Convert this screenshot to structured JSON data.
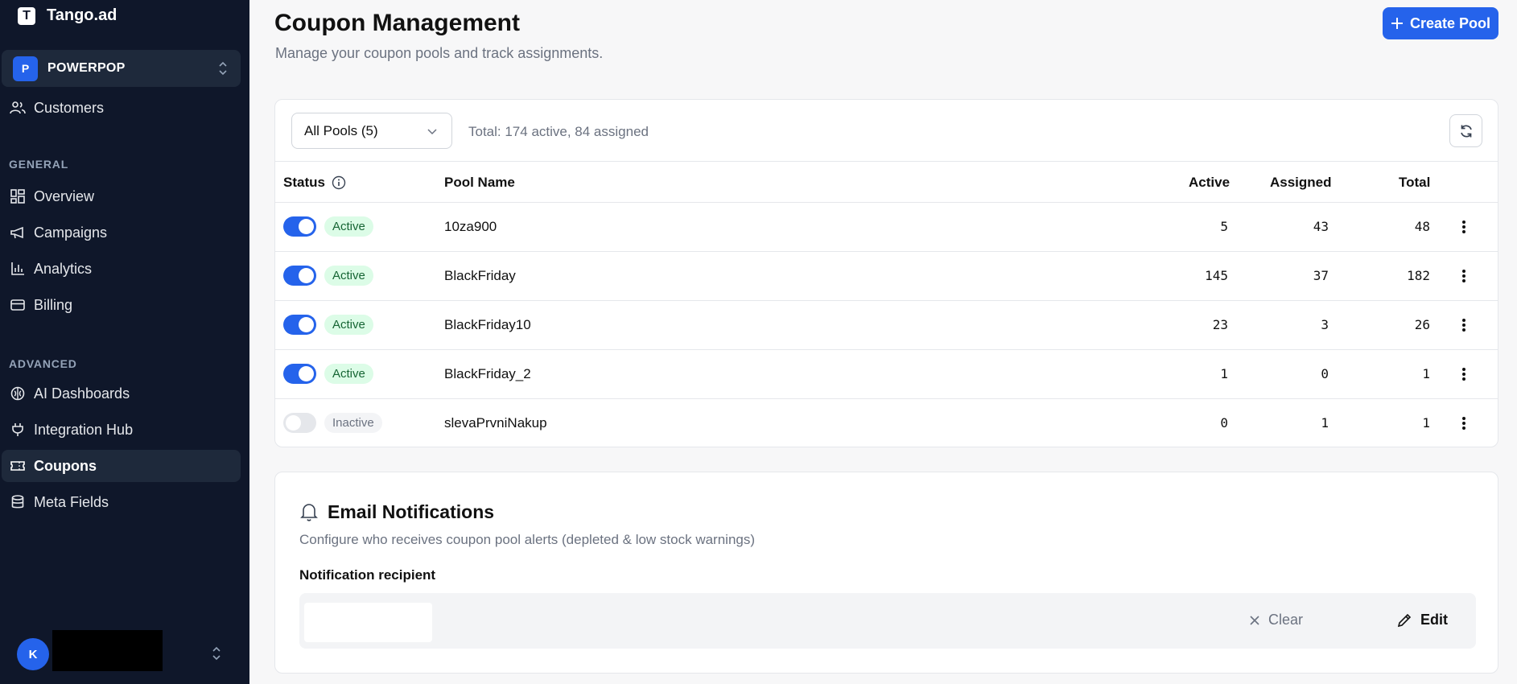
{
  "sidebar": {
    "brand": "Tango.ad",
    "brand_logo_letter": "T",
    "org_badge": "P",
    "org_name": "POWERPOP",
    "customers": "Customers",
    "section_general": "GENERAL",
    "section_advanced": "ADVANCED",
    "items": [
      {
        "label": "Overview",
        "icon": "grid-icon"
      },
      {
        "label": "Campaigns",
        "icon": "megaphone-icon"
      },
      {
        "label": "Analytics",
        "icon": "bar-chart-icon"
      },
      {
        "label": "Billing",
        "icon": "credit-card-icon"
      },
      {
        "label": "AI Dashboards",
        "icon": "brain-icon"
      },
      {
        "label": "Integration Hub",
        "icon": "plug-icon"
      },
      {
        "label": "Coupons",
        "icon": "ticket-icon"
      },
      {
        "label": "Meta Fields",
        "icon": "database-icon"
      }
    ],
    "user_initial": "K"
  },
  "header": {
    "title": "Coupon Management",
    "subtitle": "Manage your coupon pools and track assignments.",
    "create_label": "Create Pool"
  },
  "pools": {
    "filter_value": "All Pools (5)",
    "totals": "Total: 174 active, 84 assigned",
    "columns": {
      "status": "Status",
      "pool_name": "Pool Name",
      "active": "Active",
      "assigned": "Assigned",
      "total": "Total"
    },
    "rows": [
      {
        "enabled": true,
        "status": "Active",
        "name": "10za900",
        "active": "5",
        "assigned": "43",
        "total": "48"
      },
      {
        "enabled": true,
        "status": "Active",
        "name": "BlackFriday",
        "active": "145",
        "assigned": "37",
        "total": "182"
      },
      {
        "enabled": true,
        "status": "Active",
        "name": "BlackFriday10",
        "active": "23",
        "assigned": "3",
        "total": "26"
      },
      {
        "enabled": true,
        "status": "Active",
        "name": "BlackFriday_2",
        "active": "1",
        "assigned": "0",
        "total": "1"
      },
      {
        "enabled": false,
        "status": "Inactive",
        "name": "slevaPrvniNakup",
        "active": "0",
        "assigned": "1",
        "total": "1"
      }
    ]
  },
  "notifications": {
    "title": "Email Notifications",
    "subtitle": "Configure who receives coupon pool alerts (depleted & low stock warnings)",
    "recipient_label": "Notification recipient",
    "clear_label": "Clear",
    "edit_label": "Edit"
  },
  "colors": {
    "sidebar_bg": "#0f172a",
    "accent": "#2563eb",
    "active_badge_bg": "#dcfce7",
    "active_badge_text": "#166534"
  }
}
